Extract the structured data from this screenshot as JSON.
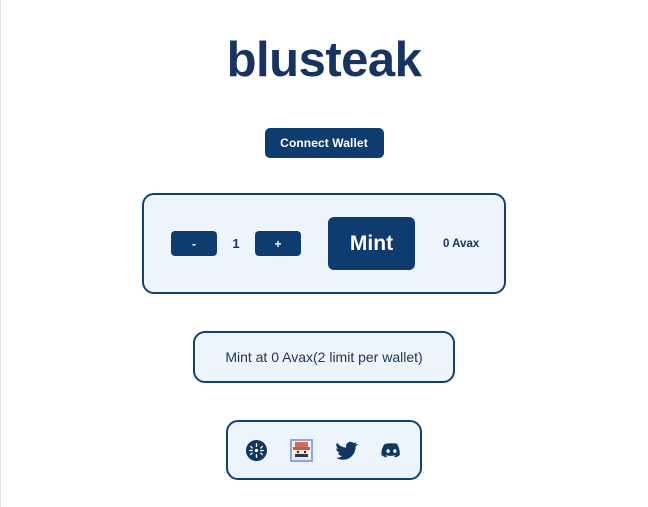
{
  "site": {
    "title": "blusteak",
    "brand_color": "#17335f",
    "accent_color": "#0f3c6e",
    "panel_bg": "#eef4fb",
    "panel_border": "#13416f"
  },
  "wallet": {
    "connect_label": "Connect Wallet"
  },
  "mint": {
    "decrement_label": "-",
    "quantity": "1",
    "increment_label": "+",
    "mint_label": "Mint",
    "price_label": "0 Avax",
    "info_label": "Mint at 0 Avax(2 limit per wallet)"
  },
  "socials": [
    {
      "name": "snowtrace-icon",
      "title": "Snowtrace"
    },
    {
      "name": "nft-collection-icon",
      "title": "Collection"
    },
    {
      "name": "twitter-icon",
      "title": "Twitter"
    },
    {
      "name": "discord-icon",
      "title": "Discord"
    }
  ]
}
